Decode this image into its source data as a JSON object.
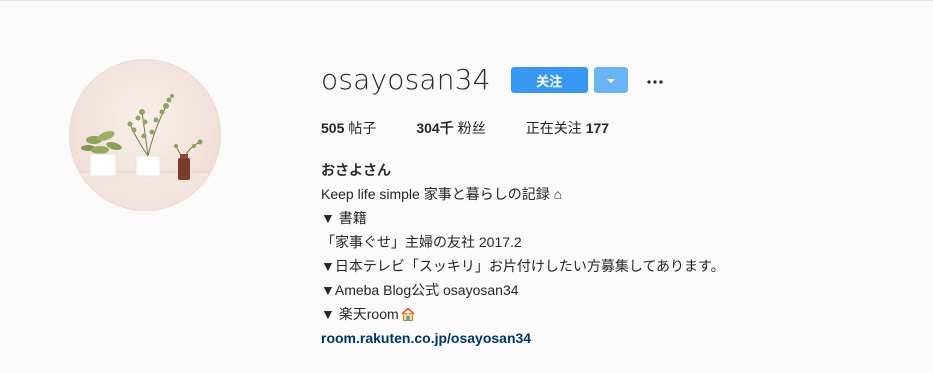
{
  "profile": {
    "username": "osayosan34",
    "follow_label": "关注",
    "dropdown_icon": "chevron-down-icon",
    "more_icon": "more-options-icon"
  },
  "stats": {
    "posts": {
      "value": "505",
      "label": "帖子"
    },
    "followers": {
      "value": "304千",
      "label": "粉丝"
    },
    "following": {
      "label": "正在关注",
      "value": "177"
    }
  },
  "bio": {
    "name": "おさよさん",
    "lines": [
      "Keep life simple 家事と暮らしの記録 ⌂",
      "▼ 書籍",
      "「家事ぐせ」主婦の友社 2017.2",
      "▼日本テレビ「スッキリ」お片付けしたい方募集してあります。",
      "▼Ameba Blog公式 osayosan34",
      "▼ 楽天room"
    ],
    "link": "room.rakuten.co.jp/osayosan34"
  },
  "colors": {
    "follow_button": "#3897f0",
    "dropdown_button": "#6ab3f5",
    "link": "#003569",
    "background": "#fafafa"
  }
}
